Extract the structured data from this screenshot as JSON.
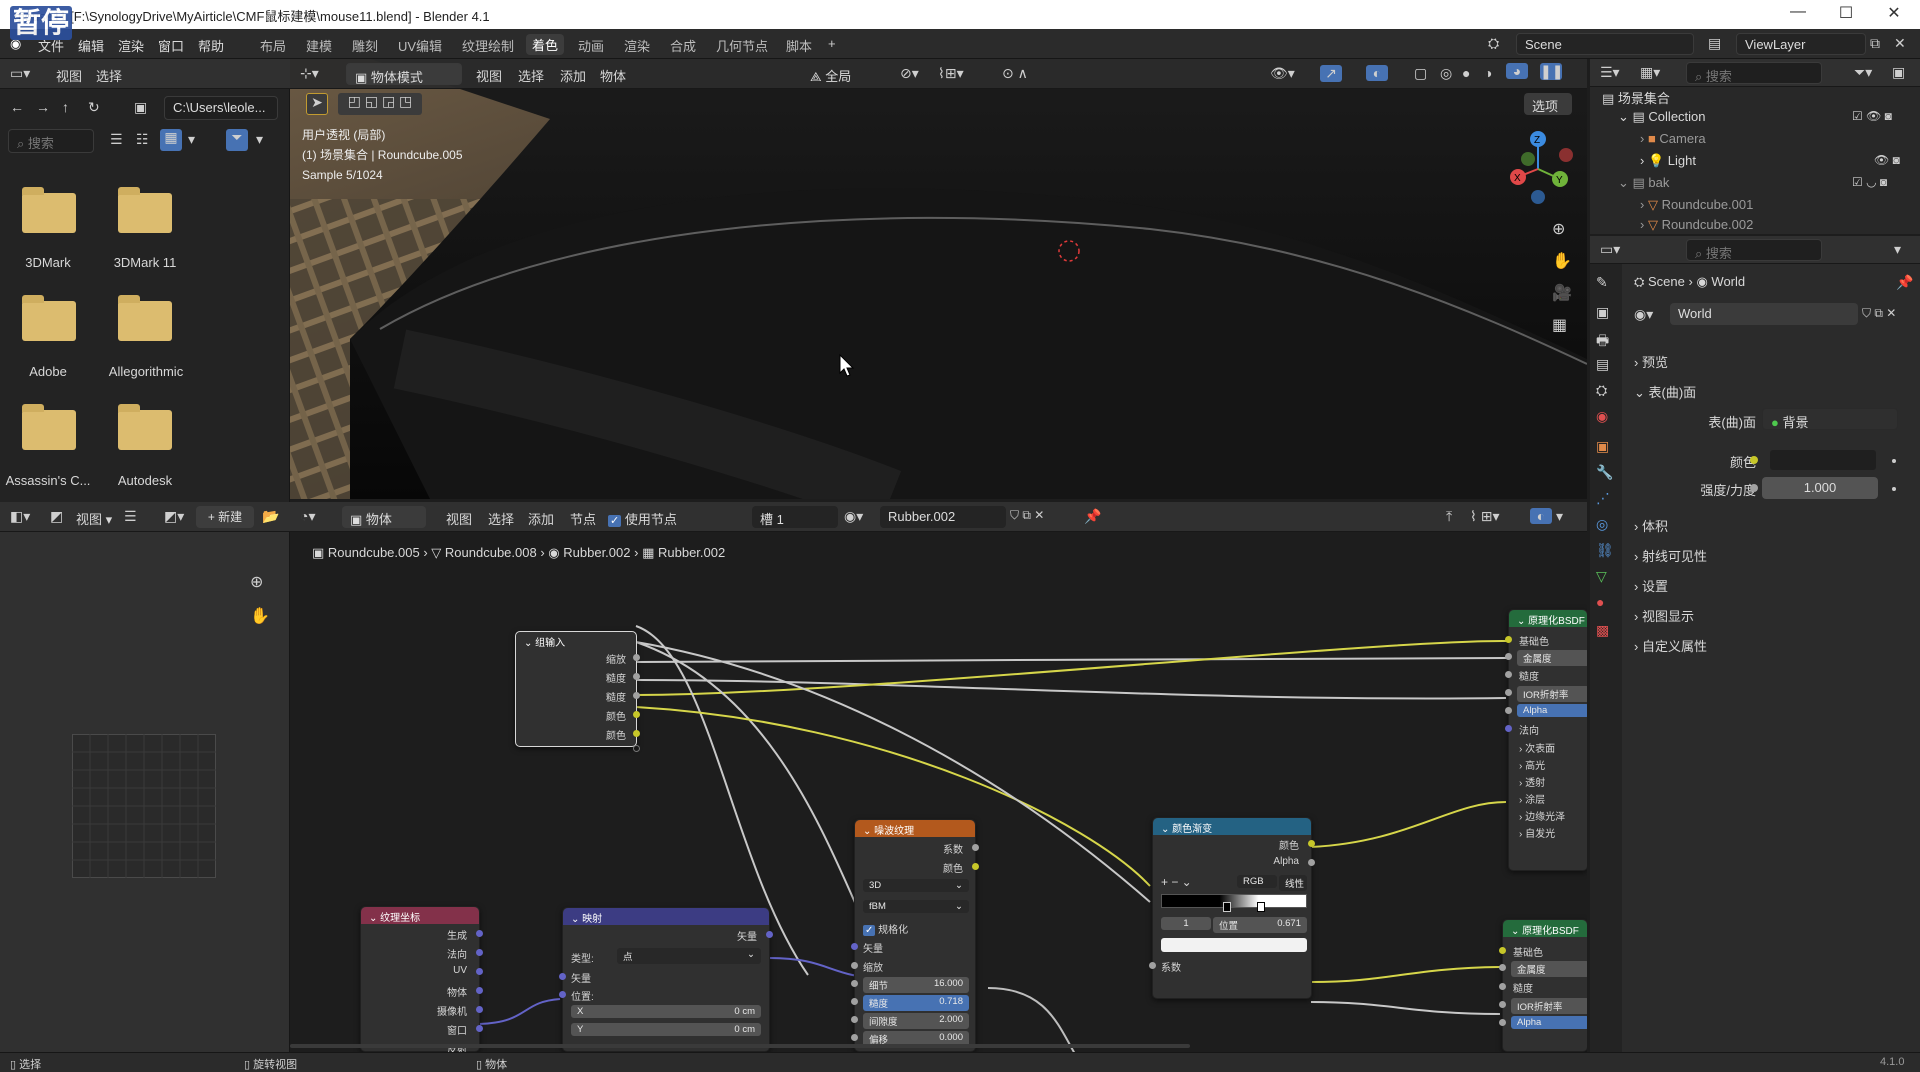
{
  "window": {
    "title": "mouse11 [F:\\SynologyDrive\\MyAirticle\\CMF鼠标建模\\mouse11.blend] - Blender 4.1",
    "overlay_badge": "暂停"
  },
  "menu": [
    "文件",
    "编辑",
    "渲染",
    "窗口",
    "帮助"
  ],
  "workspaces": [
    "布局",
    "建模",
    "雕刻",
    "UV编辑",
    "纹理绘制",
    "着色",
    "动画",
    "渲染",
    "合成",
    "几何节点",
    "脚本"
  ],
  "active_workspace": "着色",
  "scene": {
    "name": "Scene",
    "view_layer": "ViewLayer"
  },
  "file_browser": {
    "menu": [
      "视图",
      "选择"
    ],
    "path": "C:\\Users\\leole...",
    "search_placeholder": "搜索",
    "folders": [
      {
        "name": "3DMark"
      },
      {
        "name": "3DMark 11"
      },
      {
        "name": "Adobe"
      },
      {
        "name": "Allegorithmic"
      },
      {
        "name": "Assassin's C..."
      },
      {
        "name": "Autodesk"
      }
    ]
  },
  "viewport": {
    "mode": "物体模式",
    "menu": [
      "视图",
      "选择",
      "添加",
      "物体"
    ],
    "transform": "全局",
    "options": "选项",
    "overlay_lines": [
      "用户透视 (局部)",
      "(1) 场景集合 | Roundcube.005",
      "Sample 5/1024"
    ]
  },
  "outliner": {
    "search_placeholder": "搜索",
    "root": "场景集合",
    "items": [
      {
        "name": "Collection"
      },
      {
        "name": "Camera"
      },
      {
        "name": "Light"
      },
      {
        "name": "bak"
      },
      {
        "name": "Roundcube.001"
      },
      {
        "name": "Roundcube.002"
      }
    ]
  },
  "properties": {
    "search_placeholder": "搜索",
    "breadcrumb": [
      "Scene",
      "World"
    ],
    "world_name": "World",
    "panels": {
      "preview": "预览",
      "surface": "表(曲)面",
      "volume": "体积",
      "ray_visibility": "射线可见性",
      "settings": "设置",
      "viewport_display": "视图显示",
      "custom_props": "自定义属性"
    },
    "surface_label": "表(曲)面",
    "surface_value": "背景",
    "color_label": "颜色",
    "strength_label": "强度/力度",
    "strength_value": "1.000"
  },
  "image_editor": {
    "view": "视图",
    "new": "新建"
  },
  "node_editor": {
    "type": "物体",
    "menu": [
      "视图",
      "选择",
      "添加",
      "节点"
    ],
    "use_nodes": "使用节点",
    "slot": "槽 1",
    "material": "Rubber.002",
    "breadcrumb": [
      "Roundcube.005",
      "Roundcube.008",
      "Rubber.002",
      "Rubber.002"
    ]
  },
  "nodes": {
    "group_input": {
      "title": "组输入",
      "outputs": [
        "缩放",
        "糙度",
        "糙度",
        "颜色",
        "颜色"
      ]
    },
    "texcoord": {
      "title": "纹理坐标",
      "outputs": [
        "生成",
        "法向",
        "UV",
        "物体",
        "摄像机",
        "窗口",
        "反射"
      ]
    },
    "mapping": {
      "title": "映射",
      "output": "矢量",
      "type_label": "类型:",
      "type_value": "点",
      "vector": "矢量",
      "location": "位置:",
      "x_label": "X",
      "x_value": "0 cm",
      "y_label": "Y",
      "y_value": "0 cm"
    },
    "noise": {
      "title": "噪波纹理",
      "outputs": [
        "系数",
        "颜色"
      ],
      "dim": "3D",
      "kind": "fBM",
      "normalize": "规格化",
      "inputs": [
        "矢量",
        "缩放"
      ],
      "detail_label": "细节",
      "detail_value": "16.000",
      "rough_label": "糙度",
      "rough_value": "0.718",
      "lacunarity_label": "间隙度",
      "lacunarity_value": "2.000",
      "extra_label": "偏移",
      "extra_value": "0.000"
    },
    "colorramp": {
      "title": "颜色渐变",
      "outputs": [
        "颜色",
        "Alpha"
      ],
      "mode": "RGB",
      "interp": "线性",
      "index": "1",
      "pos_label": "位置",
      "pos_value": "0.671",
      "input": "系数"
    },
    "bsdf1": {
      "title": "原理化BSDF",
      "rows": [
        "基础色",
        "金属度",
        "糙度",
        "IOR折射率",
        "Alpha",
        "法向",
        "次表面",
        "高光",
        "透射",
        "涂层",
        "边缘光泽",
        "自发光"
      ]
    },
    "bsdf2": {
      "title": "原理化BSDF",
      "rows": [
        "基础色",
        "金属度",
        "糙度",
        "IOR折射率",
        "Alpha"
      ]
    }
  },
  "status": {
    "select": "选择",
    "rotate": "旋转视图",
    "object": "物体",
    "version": "4.1.0"
  }
}
